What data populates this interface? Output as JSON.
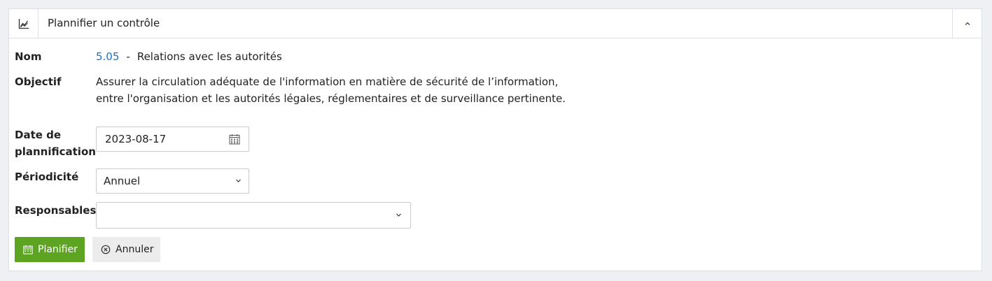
{
  "panel": {
    "title": "Plannifier un contrôle",
    "header_icon": "chart-line-icon",
    "collapse_icon": "chevron-up-icon"
  },
  "fields": {
    "name_label": "Nom",
    "name_code": "5.05",
    "name_separator": "-",
    "name_text": "Relations avec les autorités",
    "objective_label": "Objectif",
    "objective_text": "Assurer la circulation adéquate de l'information en matière de sécurité de l’information, entre l'organisation et les autorités légales, réglementaires et de surveillance pertinente.",
    "date_label_line1": "Date de",
    "date_label_line2": "plannification",
    "date_value": "2023-08-17",
    "periodicity_label": "Périodicité",
    "periodicity_value": "Annuel",
    "responsables_label": "Responsables",
    "responsables_value": ""
  },
  "actions": {
    "plan_label": "Planifier",
    "cancel_label": "Annuler"
  },
  "colors": {
    "primary": "#5da423",
    "link": "#1a73c8"
  }
}
